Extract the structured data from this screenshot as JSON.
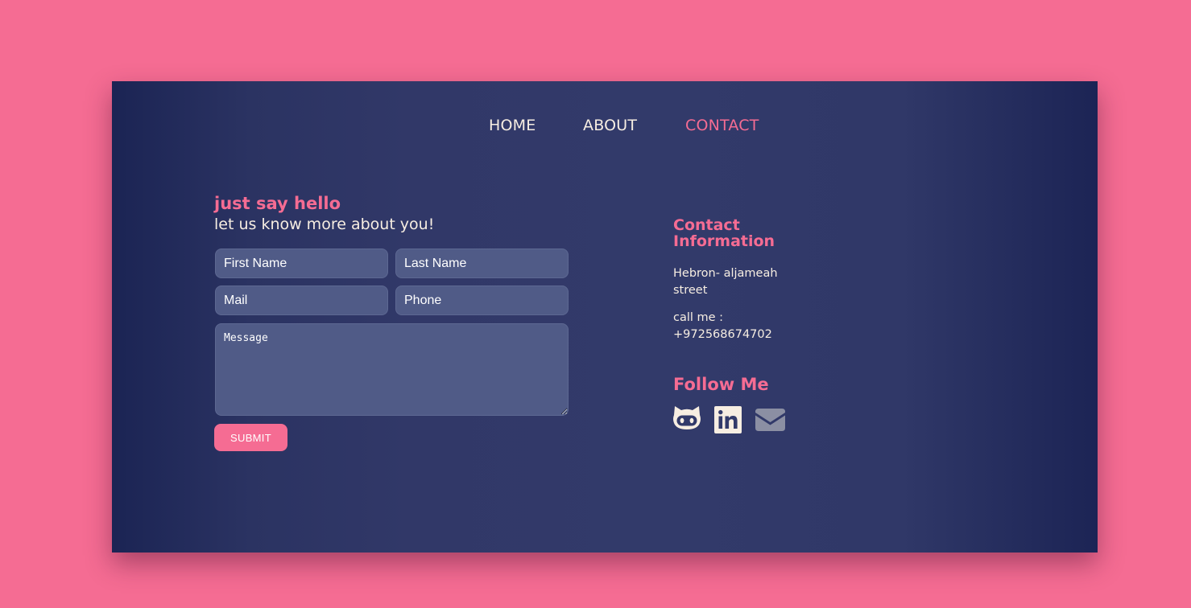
{
  "nav": {
    "items": [
      {
        "label": "HOME",
        "active": false
      },
      {
        "label": "ABOUT",
        "active": false
      },
      {
        "label": "CONTACT",
        "active": true
      }
    ]
  },
  "form": {
    "heading": "just say hello",
    "subheading": "let us know more about you!",
    "first_name_placeholder": "First Name",
    "last_name_placeholder": "Last Name",
    "mail_placeholder": "Mail",
    "phone_placeholder": "Phone",
    "message_placeholder": "Message",
    "submit_label": "SUBMIT"
  },
  "contact_info": {
    "title": "Contact Information",
    "address": "Hebron- aljameah street",
    "phone": "call me : +972568674702"
  },
  "follow": {
    "title": "Follow Me",
    "icons": [
      "github-icon",
      "linkedin-icon",
      "mail-icon"
    ]
  },
  "colors": {
    "background": "#f56c93",
    "card": "#313868",
    "accent": "#f56c93",
    "text": "#f7eee2",
    "input": "#505b87"
  }
}
